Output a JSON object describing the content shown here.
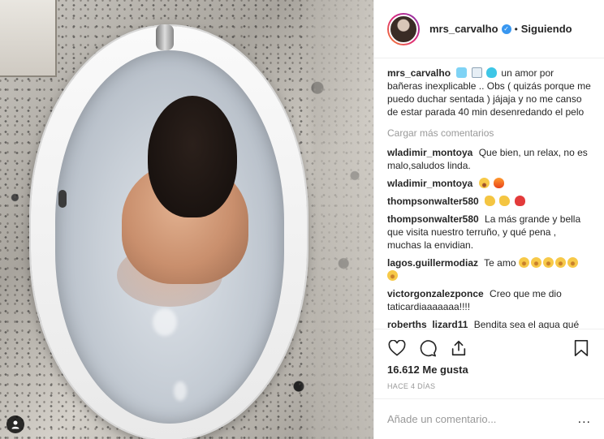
{
  "post": {
    "username": "mrs_carvalho",
    "follow_status": "Siguiendo",
    "caption": {
      "user": "mrs_carvalho",
      "text": "un amor por bañeras inexplicable .. Obs ( quizás porque me puedo duchar sentada ) jájaja y no me canso de estar parada 40 min desenredando el pelo"
    },
    "load_more": "Cargar más comentarios",
    "comments": [
      {
        "user": "wladimir_montoya",
        "text": "Que bien, un relax, no es malo,saludos linda."
      },
      {
        "user": "wladimir_montoya",
        "text": ""
      },
      {
        "user": "thompsonwalter580",
        "text": ""
      },
      {
        "user": "thompsonwalter580",
        "text": "La más grande y bella que visita nuestro terruño, y qué pena , muchas la envidian."
      },
      {
        "user": "lagos.guillermodiaz",
        "text": "Te amo"
      },
      {
        "user": "victorgonzalezponce",
        "text": "Creo que me dio taticardiaaaaaaa!!!!"
      },
      {
        "user": "roberths_lizard11",
        "text": "Bendita sea el agua qué"
      }
    ],
    "likes": "16.612 Me gusta",
    "time_ago": "HACE 4 DÍAS",
    "comment_placeholder": "Añade un comentario...",
    "more_options": "..."
  },
  "icons": {
    "verified": "verified-badge-icon",
    "like": "heart-outline-icon",
    "comment": "speech-bubble-icon",
    "share": "share-upload-icon",
    "save": "bookmark-icon",
    "tagged": "user-tag-icon"
  },
  "colors": {
    "verified_blue": "#3897f0",
    "text": "#262626",
    "muted": "#999999",
    "border": "#efefef"
  }
}
